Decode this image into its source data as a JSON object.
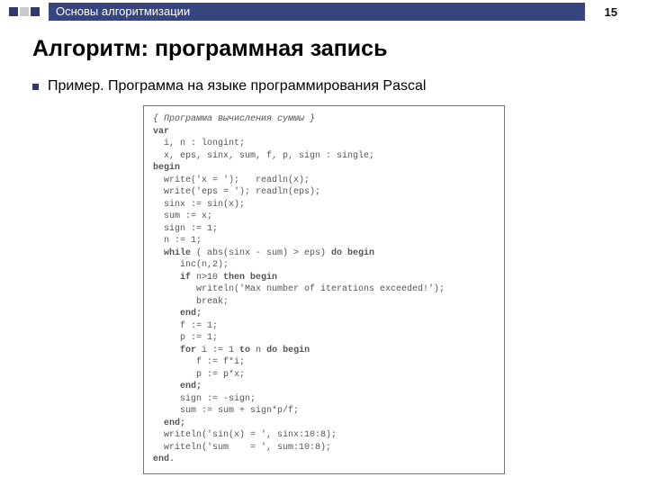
{
  "header": {
    "breadcrumb": "Основы алгоритмизации",
    "page_number": "15"
  },
  "title": "Алгоритм: программная запись",
  "bullet": "Пример. Программа на языке программирования Pascal",
  "code": {
    "l01_comment": "{ Программа вычисления суммы }",
    "l02": "var",
    "l03": "  i, n : longint;",
    "l04": "  x, eps, sinx, sum, f, p, sign : single;",
    "l05": "begin",
    "l06": "  write('x = ');   readln(x);",
    "l07": "  write('eps = '); readln(eps);",
    "l08": "  sinx := sin(x);",
    "l09": "  sum := x;",
    "l10": "  sign := 1;",
    "l11": "  n := 1;",
    "l12a": "  while",
    "l12b": " ( abs(sinx - sum) > eps) ",
    "l12c": "do begin",
    "l13": "     inc(n,2);",
    "l14a": "     if",
    "l14b": " n>10 ",
    "l14c": "then begin",
    "l15": "        writeln('Max number of iterations exceeded!');",
    "l16": "        break;",
    "l17": "     end;",
    "l18": "     f := 1;",
    "l19": "     p := 1;",
    "l20a": "     for",
    "l20b": " i := 1 ",
    "l20c": "to",
    "l20d": " n ",
    "l20e": "do begin",
    "l21": "        f := f*i;",
    "l22": "        p := p*x;",
    "l23": "     end;",
    "l24": "     sign := -sign;",
    "l25": "     sum := sum + sign*p/f;",
    "l26": "  end;",
    "l27": "  writeln('sin(x) = ', sinx:10:8);",
    "l28": "  writeln('sum    = ', sum:10:8);",
    "l29": "end."
  }
}
